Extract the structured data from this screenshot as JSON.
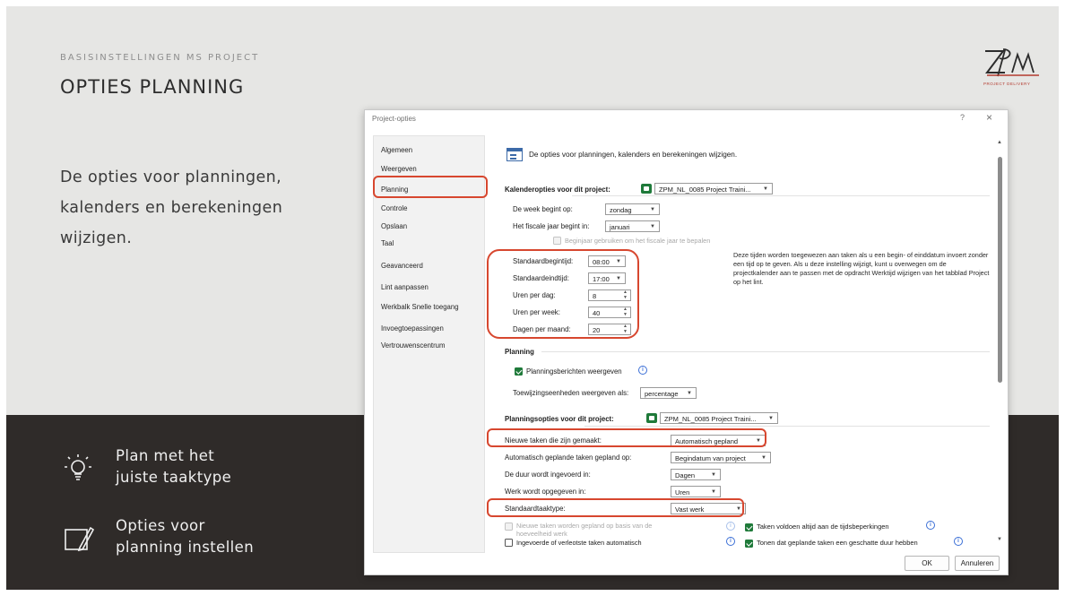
{
  "slide": {
    "kicker": "BASISINSTELLINGEN MS PROJECT",
    "title": "OPTIES PLANNING",
    "logo_text": "ZPM",
    "logo_tagline": "PROJECT DELIVERY",
    "body": [
      "De opties voor planningen,",
      "kalenders en berekeningen",
      "wijzigen."
    ],
    "tips": [
      {
        "icon": "lightbulb-icon",
        "lines": [
          "Plan met het",
          "juiste taaktype"
        ]
      },
      {
        "icon": "edit-icon",
        "lines": [
          "Opties voor",
          "planning instellen"
        ]
      }
    ],
    "accent_color": "#d7472f",
    "dark_color": "#2f2b29"
  },
  "dialog": {
    "title": "Project-opties",
    "help": "?",
    "close": "×",
    "nav": [
      "Algemeen",
      "Weergeven",
      "Planning",
      "Controle",
      "Opslaan",
      "Taal",
      "Geavanceerd",
      "Lint aanpassen",
      "Werkbalk Snelle toegang",
      "Invoegtoepassingen",
      "Vertrouwenscentrum"
    ],
    "selected_nav": "Planning",
    "header": "De opties voor planningen, kalenders en berekeningen wijzigen.",
    "calendar": {
      "heading": "Kalenderopties voor dit project:",
      "project": "ZPM_NL_0085 Project Traini...",
      "week_label": "De week begint op:",
      "week_value": "zondag",
      "fiscal_label": "Het fiscale jaar begint in:",
      "fiscal_value": "januari",
      "fiscal_check": "Beginjaar gebruiken om het fiscale jaar te bepalen",
      "start_label": "Standaardbegintijd:",
      "start_value": "08:00",
      "end_label": "Standaardeindtijd:",
      "end_value": "17:00",
      "hpd_label": "Uren per dag:",
      "hpd_value": "8",
      "hpw_label": "Uren per week:",
      "hpw_value": "40",
      "dpm_label": "Dagen per maand:",
      "dpm_value": "20",
      "note": "Deze tijden worden toegewezen aan taken als u een begin- of einddatum invoert zonder een tijd op te geven. Als u deze instelling wijzigt, kunt u overwegen om de projectkalender aan te passen met de opdracht Werktijd wijzigen van het tabblad Project op het lint."
    },
    "planning": {
      "heading": "Planning",
      "msg_check": "Planningsberichten weergeven",
      "units_label": "Toewijzingseenheden weergeven als:",
      "units_value": "percentage"
    },
    "schedule": {
      "heading": "Planningsopties voor dit project:",
      "project": "ZPM_NL_0085 Project Traini...",
      "newtask_label": "Nieuwe taken die zijn gemaakt:",
      "newtask_value": "Automatisch gepland",
      "auto_label": "Automatisch geplande taken gepland op:",
      "auto_value": "Begindatum van project",
      "dur_label": "De duur wordt ingevoerd in:",
      "dur_value": "Dagen",
      "work_label": "Werk wordt opgegeven in:",
      "work_value": "Uren",
      "tasktype_label": "Standaardtaaktype:",
      "tasktype_value": "Vast werk",
      "effort_check": "Nieuwe taken worden gepland op basis van de hoeveelheid werk",
      "constraint_check": "Taken voldoen altijd aan de tijdsbeperkingen",
      "estimate_check": "Tonen dat geplande taken een geschatte duur hebben",
      "split_check": "Ingevoerde of verleotste taken automatisch"
    },
    "ok": "OK",
    "cancel": "Annuleren"
  }
}
